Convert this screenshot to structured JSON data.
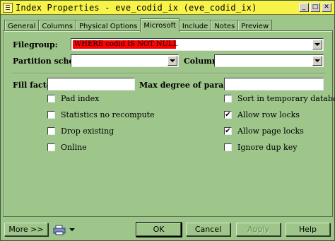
{
  "window": {
    "title": "Index Properties - eve_codid_ix (eve_codid_ix)",
    "controls": {
      "minimize": "_",
      "maximize": "□",
      "close": "✕"
    }
  },
  "tabs": [
    "General",
    "Columns",
    "Physical Options",
    "Microsoft",
    "Include",
    "Notes",
    "Preview"
  ],
  "active_tab": "Microsoft",
  "fields": {
    "filegroup_label": "Filegroup:",
    "filegroup_value": "WHERE codid IS NOT NULL",
    "filegroup_value_bg": "#ff0000",
    "partition_label": "Partition scheme:",
    "partition_value": "",
    "column_label": "Column:",
    "column_value": "",
    "fill_factor_label": "Fill factor:",
    "fill_factor_value": "",
    "maxdop_label": "Max degree of parallelism:",
    "maxdop_value": ""
  },
  "options_left": [
    {
      "label": "Pad index",
      "checked": false
    },
    {
      "label": "Statistics no recompute",
      "checked": false
    },
    {
      "label": "Drop existing",
      "checked": false
    },
    {
      "label": "Online",
      "checked": false
    }
  ],
  "options_right": [
    {
      "label": "Sort in temporary database",
      "checked": false
    },
    {
      "label": "Allow row locks",
      "checked": true
    },
    {
      "label": "Allow page locks",
      "checked": true
    },
    {
      "label": "Ignore dup key",
      "checked": false
    }
  ],
  "buttons": {
    "more": "More >>",
    "ok": "OK",
    "cancel": "Cancel",
    "apply": "Apply",
    "help": "Help"
  },
  "icons": {
    "window": "table-icon",
    "print": "printer-icon",
    "print_dropdown": "chevron-down-icon"
  },
  "colors": {
    "background": "#9ec58a",
    "titlebar": "#f7f34a"
  }
}
